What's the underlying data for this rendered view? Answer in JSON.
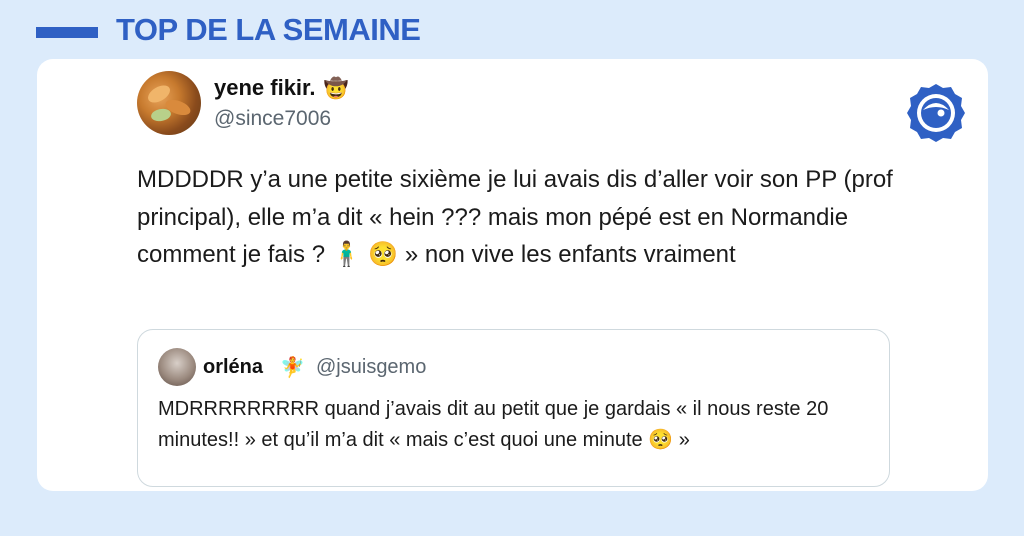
{
  "header": {
    "title": "TOP DE LA SEMAINE"
  },
  "tweet": {
    "author_name": "yene fikir.",
    "author_emoji": "🤠",
    "author_handle": "@since7006",
    "text": "MDDDDR y’a une petite sixième je lui avais dis d’aller voir son PP (prof principal), elle m’a dit « hein ??? mais mon pépé est en Normandie comment je fais ? 🧍‍♂️ 🥺 » non vive les enfants vraiment"
  },
  "quoted_tweet": {
    "author_name": "orléna",
    "author_emoji": "🧚",
    "author_handle": "@jsuisgemo",
    "text": "MDRRRRRRRRR quand j’avais dit au petit que je gardais « il nous reste 20 minutes!! » et qu’il m’a dit « mais c’est quoi une minute 🥺 »"
  },
  "colors": {
    "background": "#dcebfb",
    "accent": "#2f60c4",
    "card": "#ffffff",
    "handle_gray": "#5b6670"
  },
  "icons": {
    "brand_logo": "brand-logo-icon"
  }
}
